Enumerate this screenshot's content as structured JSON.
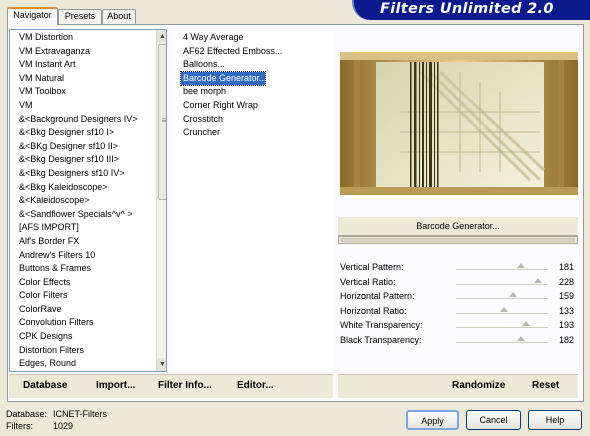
{
  "banner": {
    "title": "Filters Unlimited 2.0"
  },
  "tabs": [
    {
      "label": "Navigator",
      "active": true
    },
    {
      "label": "Presets",
      "active": false
    },
    {
      "label": "About",
      "active": false
    }
  ],
  "categories": [
    "VM Distortion",
    "VM Extravaganza",
    "VM Instant Art",
    "VM Natural",
    "VM Toolbox",
    "VM",
    "&<Background Designers IV>",
    "&<Bkg Designer sf10 I>",
    "&<BKg Designer sf10 II>",
    "&<Bkg Designer sf10 III>",
    "&<Bkg Designers sf10 IV>",
    "&<Bkg Kaleidoscope>",
    "&<Kaleidoscope>",
    "&<Sandflower Specials^v^ >",
    "[AFS IMPORT]",
    "Alf's Border FX",
    "Andrew's Filters 10",
    "Buttons & Frames",
    "Color Effects",
    "Color Filters",
    "ColorRave",
    "Convolution Filters",
    "CPK Designs",
    "Distortion Filters",
    "Edges, Round"
  ],
  "filters": [
    {
      "label": "4 Way Average",
      "selected": false
    },
    {
      "label": "AF62 Effected Emboss...",
      "selected": false
    },
    {
      "label": "Balloons...",
      "selected": false
    },
    {
      "label": "Barcode Generator...",
      "selected": true
    },
    {
      "label": "bee morph",
      "selected": false
    },
    {
      "label": "Corner Right Wrap",
      "selected": false
    },
    {
      "label": "Crosstitch",
      "selected": false
    },
    {
      "label": "Cruncher",
      "selected": false
    }
  ],
  "left_actions": {
    "database": "Database",
    "import": "Import...",
    "filter_info": "Filter Info...",
    "editor": "Editor..."
  },
  "right_actions": {
    "randomize": "Randomize",
    "reset": "Reset"
  },
  "filter_button": "Barcode Generator...",
  "parameters": [
    {
      "label": "Vertical Pattern:",
      "value": "181",
      "level": 0.71
    },
    {
      "label": "Vertical Ratio:",
      "value": "228",
      "level": 0.89
    },
    {
      "label": "Horizontal Pattern:",
      "value": "159",
      "level": 0.62
    },
    {
      "label": "Horizontal Ratio:",
      "value": "133",
      "level": 0.52
    },
    {
      "label": "White Transparency:",
      "value": "193",
      "level": 0.76
    },
    {
      "label": "Black Transparency:",
      "value": "182",
      "level": 0.71
    }
  ],
  "status": {
    "database_label": "Database:",
    "database_value": "ICNET-Filters",
    "filters_label": "Filters:",
    "filters_value": "1029"
  },
  "dialog_buttons": {
    "apply": "Apply",
    "cancel": "Cancel",
    "help": "Help"
  },
  "colors": {
    "banner": "#0a1a8c",
    "selection": "#316ac5",
    "preview_gold": "#c6a560",
    "preview_cream": "#e8e4c4"
  }
}
